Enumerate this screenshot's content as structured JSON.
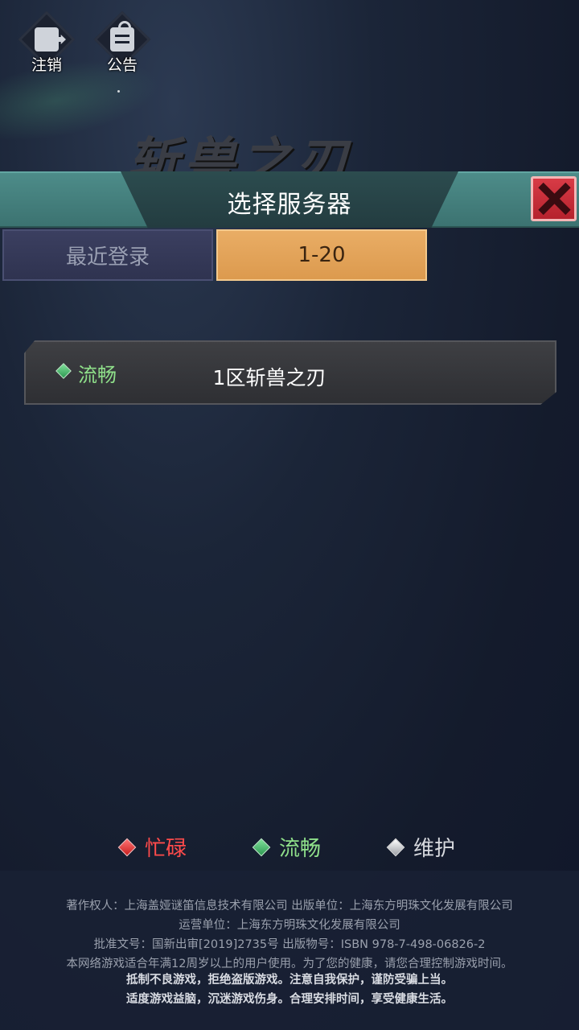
{
  "top_buttons": {
    "logout": {
      "label": "注销",
      "icon": "logout-icon"
    },
    "notice": {
      "label": "公告",
      "icon": "notice-icon"
    }
  },
  "logo": {
    "text": "斩兽之刃"
  },
  "header": {
    "title": "选择服务器",
    "close_icon": "close-icon"
  },
  "tabs": [
    {
      "label": "最近登录",
      "active": false
    },
    {
      "label": "1-20",
      "active": true
    }
  ],
  "servers": [
    {
      "status": "流畅",
      "name": "1区斩兽之刃",
      "status_color": "#8fe08a"
    }
  ],
  "legend": [
    {
      "label": "忙碌",
      "color": "#ff4b4b"
    },
    {
      "label": "流畅",
      "color": "#8fe08a"
    },
    {
      "label": "维护",
      "color": "#d7d9de"
    }
  ],
  "footer": {
    "line1": "著作权人：上海盖娅谜笛信息技术有限公司  出版单位：上海东方明珠文化发展有限公司",
    "line2": "运营单位：上海东方明珠文化发展有限公司",
    "line3": "批准文号：国新出审[2019]2735号  出版物号：ISBN 978-7-498-06826-2",
    "line4": "本网络游戏适合年满12周岁以上的用户使用。为了您的健康，请您合理控制游戏时间。",
    "line5": "抵制不良游戏，拒绝盗版游戏。注意自我保护，谨防受骗上当。",
    "line6": "适度游戏益脑，沉迷游戏伤身。合理安排时间，享受健康生活。"
  }
}
